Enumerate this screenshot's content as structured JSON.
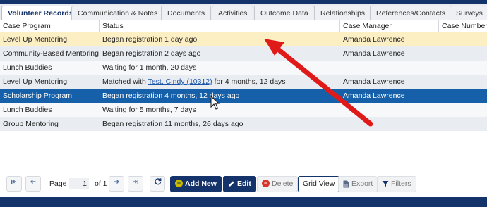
{
  "tabs": [
    {
      "label": "Volunteer Records",
      "active": true
    },
    {
      "label": "Communication & Notes"
    },
    {
      "label": "Documents"
    },
    {
      "label": "Activities"
    },
    {
      "label": "Outcome Data"
    },
    {
      "label": "Relationships"
    },
    {
      "label": "References/Contacts"
    },
    {
      "label": "Surveys"
    }
  ],
  "grid": {
    "columns": [
      "Case Program",
      "Status",
      "Case Manager",
      "Case Number"
    ],
    "rows": [
      {
        "program": "Level Up Mentoring",
        "status": "Began registration 1 day ago",
        "manager": "Amanda Lawrence"
      },
      {
        "program": "Community-Based Mentoring",
        "status": "Began registration 2 days ago",
        "manager": "Amanda Lawrence"
      },
      {
        "program": "Lunch Buddies",
        "status": "Waiting for 1 month, 20 days",
        "manager": ""
      },
      {
        "program": "Level Up Mentoring",
        "status_prefix": "Matched with ",
        "status_link": "Test, Cindy (10312)",
        "status_suffix": " for 4 months, 12 days",
        "manager": "Amanda Lawrence"
      },
      {
        "program": "Scholarship Program",
        "status": "Began registration 4 months, 12 days ago",
        "manager": "Amanda Lawrence",
        "selected": true
      },
      {
        "program": "Lunch Buddies",
        "status": "Waiting for 5 months, 7 days",
        "manager": ""
      },
      {
        "program": "Group Mentoring",
        "status": "Began registration 11 months, 26 days ago",
        "manager": ""
      }
    ]
  },
  "pager": {
    "page_label": "Page",
    "page_value": "1",
    "of_label": "of 1",
    "add_new": "Add New",
    "edit": "Edit",
    "delete": "Delete",
    "grid_view": "Grid View",
    "export": "Export",
    "filters": "Filters"
  },
  "colors": {
    "navy": "#14336b",
    "selected_row": "#1560a8",
    "highlight_row": "#fcefc4",
    "annotation_arrow": "#e01919",
    "add_icon": "#c9b800",
    "delete_icon": "#d9342b"
  }
}
